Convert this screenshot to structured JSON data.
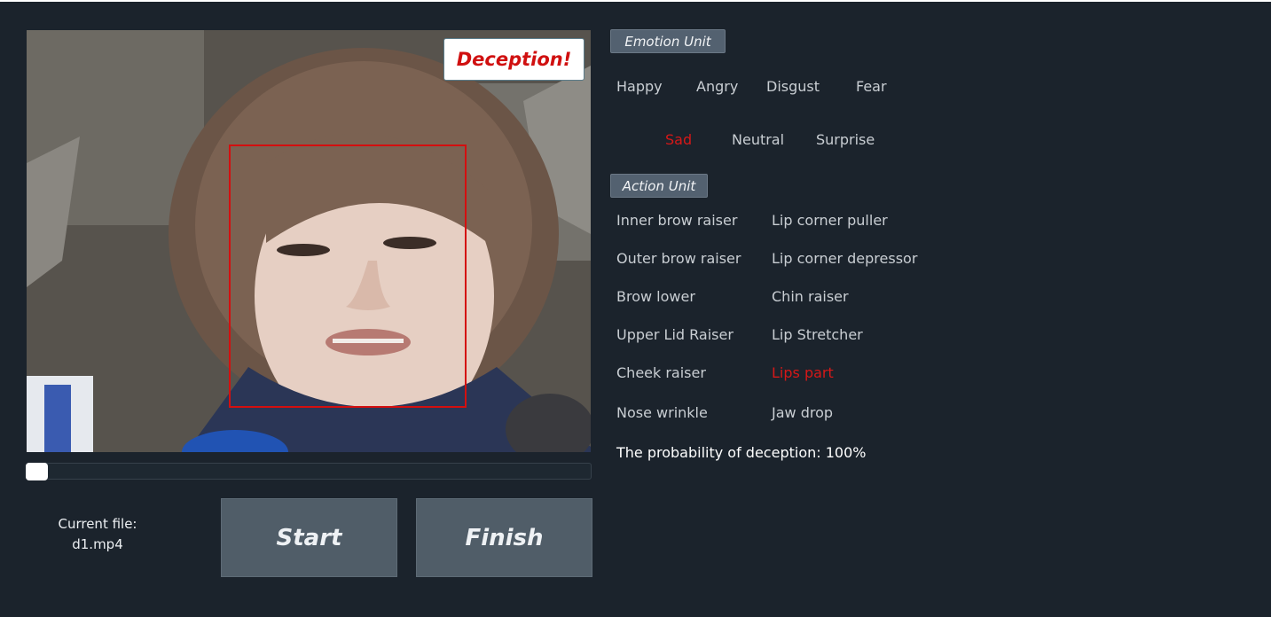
{
  "video": {
    "badge_text": "Deception!"
  },
  "playback": {
    "progress": 0.0
  },
  "file": {
    "label": "Current file:",
    "name": "d1.mp4"
  },
  "buttons": {
    "start": "Start",
    "finish": "Finish"
  },
  "emotion_unit": {
    "title": "Emotion Unit",
    "items": [
      {
        "label": "Happy",
        "active": false
      },
      {
        "label": "Angry",
        "active": false
      },
      {
        "label": "Disgust",
        "active": false
      },
      {
        "label": "Fear",
        "active": false
      },
      {
        "label": "Sad",
        "active": true
      },
      {
        "label": "Neutral",
        "active": false
      },
      {
        "label": "Surprise",
        "active": false
      }
    ]
  },
  "action_unit": {
    "title": "Action Unit",
    "items": [
      {
        "label": "Inner brow raiser",
        "active": false
      },
      {
        "label": "Lip corner puller",
        "active": false
      },
      {
        "label": "Outer brow raiser",
        "active": false
      },
      {
        "label": "Lip corner depressor",
        "active": false
      },
      {
        "label": "Brow lower",
        "active": false
      },
      {
        "label": "Chin raiser",
        "active": false
      },
      {
        "label": "Upper Lid Raiser",
        "active": false
      },
      {
        "label": "Lip Stretcher",
        "active": false
      },
      {
        "label": "Cheek raiser",
        "active": false
      },
      {
        "label": "Lips part",
        "active": true
      },
      {
        "label": "Nose wrinkle",
        "active": false
      },
      {
        "label": "Jaw drop",
        "active": false
      }
    ]
  },
  "result": {
    "probability_text": "The probability of  deception: 100%"
  },
  "colors": {
    "background": "#1b232c",
    "active_label": "#d61818",
    "face_box": "#d40f0f",
    "button": "#505d68"
  }
}
